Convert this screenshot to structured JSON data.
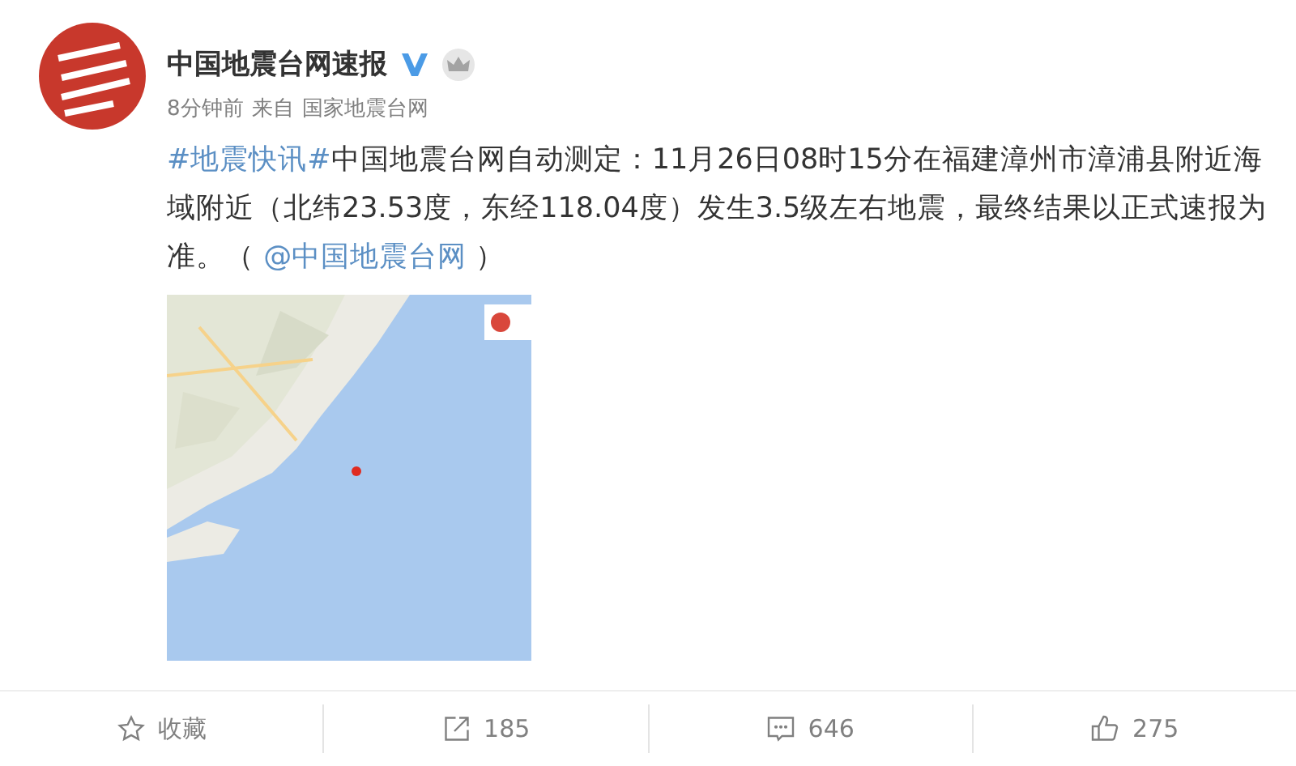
{
  "post": {
    "author": "中国地震台网速报",
    "verified": true,
    "time": "8分钟前",
    "source_prefix": "来自",
    "source": "国家地震台网",
    "text": [
      {
        "kind": "link",
        "text": "#地震快讯#"
      },
      {
        "kind": "text",
        "text": "中国地震台网自动测定：11月26日08时15分在福建漳州市漳浦县附近海域附近（北纬23.53度，东经118.04度）发生3.5级左右地震，最终结果以正式速报为准。（ "
      },
      {
        "kind": "link",
        "text": "@中国地震台网"
      },
      {
        "kind": "text",
        "text": " ）"
      }
    ]
  },
  "actions": [
    {
      "kind": "favorite",
      "label": "收藏"
    },
    {
      "kind": "repost",
      "label": "185"
    },
    {
      "kind": "comment",
      "label": "646"
    },
    {
      "kind": "like",
      "label": "275"
    }
  ]
}
